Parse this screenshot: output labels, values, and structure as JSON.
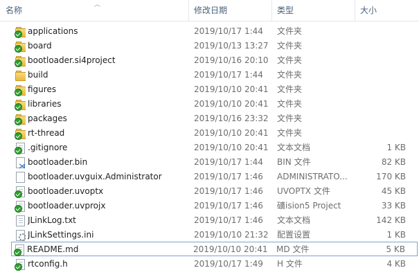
{
  "columns": {
    "name": "名称",
    "date": "修改日期",
    "type": "类型",
    "size": "大小"
  },
  "files": [
    {
      "name": "applications",
      "date": "2019/10/17 1:44",
      "type": "文件夹",
      "size": "",
      "icon": "folder-icon",
      "status": "synced"
    },
    {
      "name": "board",
      "date": "2019/10/13 13:27",
      "type": "文件夹",
      "size": "",
      "icon": "folder-icon",
      "status": "synced"
    },
    {
      "name": "bootloader.si4project",
      "date": "2019/10/16 20:10",
      "type": "文件夹",
      "size": "",
      "icon": "folder-icon",
      "status": "synced"
    },
    {
      "name": "build",
      "date": "2019/10/17 1:44",
      "type": "文件夹",
      "size": "",
      "icon": "folder-icon",
      "status": "none"
    },
    {
      "name": "figures",
      "date": "2019/10/10 20:41",
      "type": "文件夹",
      "size": "",
      "icon": "folder-icon",
      "status": "synced"
    },
    {
      "name": "libraries",
      "date": "2019/10/10 20:41",
      "type": "文件夹",
      "size": "",
      "icon": "folder-icon",
      "status": "synced"
    },
    {
      "name": "packages",
      "date": "2019/10/16 23:32",
      "type": "文件夹",
      "size": "",
      "icon": "folder-icon",
      "status": "synced"
    },
    {
      "name": "rt-thread",
      "date": "2019/10/10 20:41",
      "type": "文件夹",
      "size": "",
      "icon": "folder-icon",
      "status": "synced"
    },
    {
      "name": ".gitignore",
      "date": "2019/10/10 20:41",
      "type": "文本文档",
      "size": "1 KB",
      "icon": "text-file-icon",
      "status": "synced"
    },
    {
      "name": "bootloader.bin",
      "date": "2019/10/17 1:44",
      "type": "BIN 文件",
      "size": "82 KB",
      "icon": "vs-file-icon",
      "status": "none"
    },
    {
      "name": "bootloader.uvguix.Administrator",
      "date": "2019/10/17 1:46",
      "type": "ADMINISTRATO...",
      "size": "170 KB",
      "icon": "blank-file-icon",
      "status": "none"
    },
    {
      "name": "bootloader.uvoptx",
      "date": "2019/10/17 1:46",
      "type": "UVOPTX 文件",
      "size": "45 KB",
      "icon": "text-file-icon",
      "status": "synced"
    },
    {
      "name": "bootloader.uvprojx",
      "date": "2019/10/17 1:46",
      "type": "礦ision5 Project",
      "size": "33 KB",
      "icon": "text-file-icon",
      "status": "synced"
    },
    {
      "name": "JLinkLog.txt",
      "date": "2019/10/17 1:46",
      "type": "文本文档",
      "size": "142 KB",
      "icon": "text-file-icon",
      "status": "none"
    },
    {
      "name": "JLinkSettings.ini",
      "date": "2019/10/10 21:32",
      "type": "配置设置",
      "size": "1 KB",
      "icon": "settings-file-icon",
      "status": "none"
    },
    {
      "name": "README.md",
      "date": "2019/10/10 20:41",
      "type": "MD 文件",
      "size": "5 KB",
      "icon": "text-file-icon",
      "status": "synced",
      "selected": true
    },
    {
      "name": "rtconfig.h",
      "date": "2019/10/17 1:49",
      "type": "H 文件",
      "size": "4 KB",
      "icon": "text-file-icon",
      "status": "synced"
    }
  ],
  "colors": {
    "header_text": "#4c607a",
    "selection_border": "#7da2ce",
    "sync_badge": "#2f9e2f"
  }
}
